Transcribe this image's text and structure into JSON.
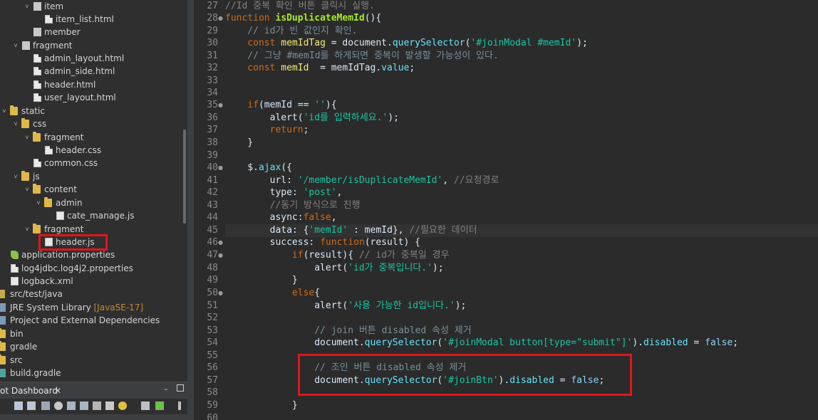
{
  "explorer": {
    "rows": [
      {
        "label": "item",
        "icon": "package-icon",
        "chev": "v"
      },
      {
        "label": "item_list.html",
        "icon": "html-file-icon"
      },
      {
        "label": "member",
        "icon": "package-icon"
      },
      {
        "label": "fragment",
        "icon": "package-icon",
        "chev": "v"
      },
      {
        "label": "admin_layout.html",
        "icon": "html-file-icon"
      },
      {
        "label": "admin_side.html",
        "icon": "html-file-icon"
      },
      {
        "label": "header.html",
        "icon": "html-file-icon"
      },
      {
        "label": "user_layout.html",
        "icon": "html-file-icon"
      },
      {
        "label": "static",
        "icon": "folder-icon",
        "chev": "v"
      },
      {
        "label": "css",
        "icon": "folder-icon",
        "chev": "v"
      },
      {
        "label": "fragment",
        "icon": "folder-icon",
        "chev": "v"
      },
      {
        "label": "header.css",
        "icon": "css-file-icon"
      },
      {
        "label": "common.css",
        "icon": "css-file-icon"
      },
      {
        "label": "js",
        "icon": "folder-icon",
        "chev": "v"
      },
      {
        "label": "content",
        "icon": "folder-icon",
        "chev": "v"
      },
      {
        "label": "admin",
        "icon": "folder-icon",
        "chev": "v"
      },
      {
        "label": "cate_manage.js",
        "icon": "js-file-icon"
      },
      {
        "label": "fragment",
        "icon": "folder-icon",
        "chev": "v"
      },
      {
        "label": "header.js",
        "icon": "js-file-icon"
      },
      {
        "label": "application.properties",
        "icon": "properties-file-icon"
      },
      {
        "label": "log4jdbc.log4j2.properties",
        "icon": "properties-file-icon"
      },
      {
        "label": "logback.xml",
        "icon": "xml-file-icon"
      },
      {
        "label": "src/test/java",
        "icon": "source-folder-icon"
      },
      {
        "label": "JRE System Library",
        "tag": "[JavaSE-17]",
        "icon": "library-icon"
      },
      {
        "label": "Project and External Dependencies",
        "icon": "library-icon"
      },
      {
        "label": "bin",
        "icon": "folder-icon"
      },
      {
        "label": "gradle",
        "icon": "folder-icon"
      },
      {
        "label": "src",
        "icon": "folder-icon"
      },
      {
        "label": "build.gradle",
        "icon": "gradle-file-icon"
      }
    ]
  },
  "dashboard": {
    "tab_label": "ot Dashboard",
    "close_glyph": "✕",
    "minimize_glyph": "–"
  },
  "editor": {
    "lines": [
      {
        "n": "27",
        "fold": ""
      },
      {
        "n": "28",
        "fold": "●"
      },
      {
        "n": "29",
        "fold": ""
      },
      {
        "n": "30",
        "fold": ""
      },
      {
        "n": "31",
        "fold": ""
      },
      {
        "n": "32",
        "fold": ""
      },
      {
        "n": "33",
        "fold": ""
      },
      {
        "n": "34",
        "fold": ""
      },
      {
        "n": "35",
        "fold": "●"
      },
      {
        "n": "36",
        "fold": ""
      },
      {
        "n": "37",
        "fold": ""
      },
      {
        "n": "38",
        "fold": ""
      },
      {
        "n": "39",
        "fold": ""
      },
      {
        "n": "40",
        "fold": "●"
      },
      {
        "n": "41",
        "fold": ""
      },
      {
        "n": "42",
        "fold": ""
      },
      {
        "n": "43",
        "fold": ""
      },
      {
        "n": "44",
        "fold": ""
      },
      {
        "n": "45",
        "fold": ""
      },
      {
        "n": "46",
        "fold": "●"
      },
      {
        "n": "47",
        "fold": "●"
      },
      {
        "n": "48",
        "fold": ""
      },
      {
        "n": "49",
        "fold": ""
      },
      {
        "n": "50",
        "fold": "●"
      },
      {
        "n": "51",
        "fold": ""
      },
      {
        "n": "52",
        "fold": ""
      },
      {
        "n": "53",
        "fold": ""
      },
      {
        "n": "54",
        "fold": ""
      },
      {
        "n": "55",
        "fold": ""
      },
      {
        "n": "56",
        "fold": ""
      },
      {
        "n": "57",
        "fold": ""
      },
      {
        "n": "58",
        "fold": ""
      },
      {
        "n": "59",
        "fold": ""
      },
      {
        "n": "60",
        "fold": ""
      }
    ],
    "code": {
      "l27": "//Id 중복 확인 버튼 클릭시 실행.",
      "l28_kw": "function",
      "l28_fn": " isDuplicateMemId",
      "l28_rest": "(){",
      "l29": "    // id가 빈 값인지 확인.",
      "l30_kw": "    const",
      "l30_var": " memIdTag",
      "l30_a": " = document.",
      "l30_prop": "querySelector",
      "l30_b": "(",
      "l30_str": "'#joinModal #memId'",
      "l30_c": ");",
      "l31": "    // 그냥 #memId를 하게되면 중복이 발생할 가능성이 있다.",
      "l32_kw": "    const",
      "l32_var": " memId",
      "l32_a": "  = memIdTag.",
      "l32_prop": "value",
      "l32_b": ";",
      "l35_kw": "    if",
      "l35_a": "(memId == ",
      "l35_str": "''",
      "l35_b": "){",
      "l36_a": "        alert(",
      "l36_str": "'id를 입력하세요.'",
      "l36_b": ");",
      "l37_kw": "        return",
      "l37_b": ";",
      "l38": "    }",
      "l40_a": "    $.",
      "l40_prop": "ajax",
      "l40_b": "({",
      "l41_a": "        url: ",
      "l41_str": "'/member/isDuplicateMemId'",
      "l41_b": ", ",
      "l41_cmt": "//요청경로",
      "l42_a": "        type: ",
      "l42_str": "'post'",
      "l42_b": ",",
      "l43": "        //동기 방식으로 진행",
      "l44_a": "        async:",
      "l44_kw": "false",
      "l44_b": ",",
      "l45_a": "        data: {",
      "l45_str": "'memId'",
      "l45_b": " : memId}, ",
      "l45_cmt": "//필요한 데이터",
      "l46_a": "        success: ",
      "l46_kw": "function",
      "l46_b": "(result) {",
      "l47_kw": "            if",
      "l47_a": "(result){ ",
      "l47_cmt": "// id가 중복일 경우",
      "l48_a": "                alert(",
      "l48_str": "'id가 중복입니다.'",
      "l48_b": ");",
      "l49": "            }",
      "l50_kw": "            else",
      "l50_b": "{",
      "l51_a": "                alert(",
      "l51_str": "'사용 가능한 id입니다.'",
      "l51_b": ");",
      "l53": "                // join 버튼 disabled 속성 제거",
      "l54_a": "                document.",
      "l54_prop": "querySelector",
      "l54_b": "(",
      "l54_str": "'#joinModal button[type=\"submit\"]'",
      "l54_c": ").",
      "l54_prop2": "disabled",
      "l54_d": " = ",
      "l54_kw": "false",
      "l54_e": ";",
      "l56": "                // 조인 버튼 disabled 속성 제거",
      "l57_a": "                document.",
      "l57_prop": "querySelector",
      "l57_b": "(",
      "l57_str": "'#joinBtn'",
      "l57_c": ").",
      "l57_prop2": "disabled",
      "l57_d": " = ",
      "l57_kw": "false",
      "l57_e": ";",
      "l59": "            }"
    }
  },
  "colors": {
    "highlight_box": "#e0161b",
    "keyword": "#cc6c1d",
    "string": "#17c6a3",
    "comment": "#808080"
  }
}
